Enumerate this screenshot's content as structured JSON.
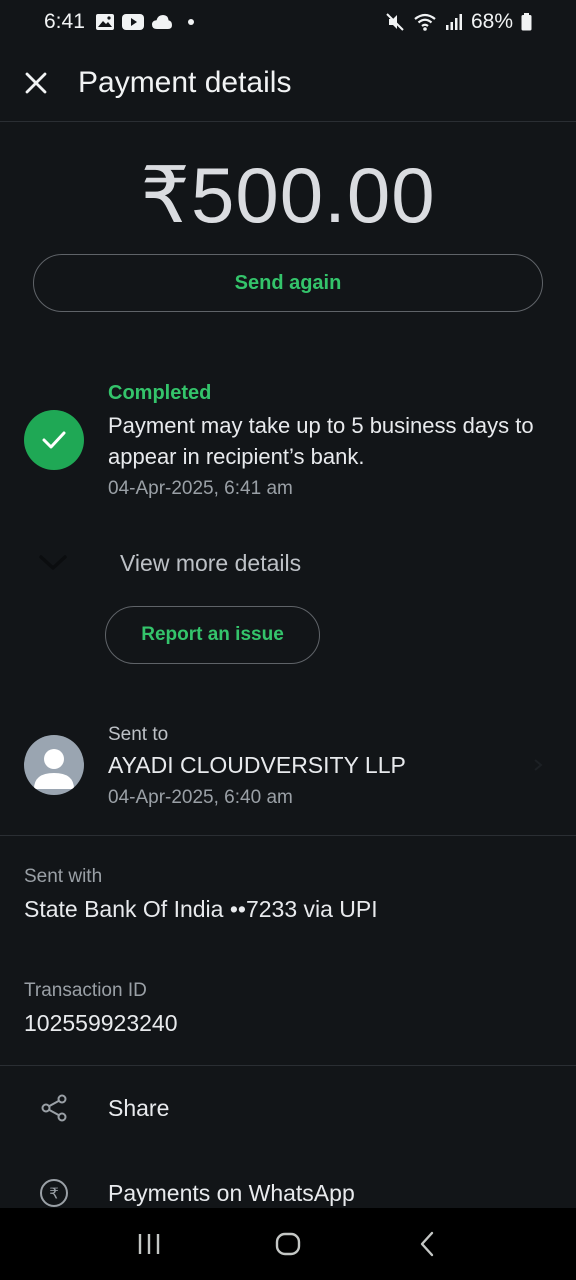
{
  "status_bar": {
    "time": "6:41",
    "battery": "68%"
  },
  "header": {
    "title": "Payment details"
  },
  "payment": {
    "amount": "₹500.00",
    "send_again_label": "Send again"
  },
  "status": {
    "label": "Completed",
    "message": "Payment may take up to 5 business days to appear in recipient’s bank.",
    "timestamp": "04-Apr-2025, 6:41 am"
  },
  "details": {
    "view_more_label": "View more details",
    "report_label": "Report an issue"
  },
  "recipient": {
    "label": "Sent to",
    "name": "AYADI CLOUDVERSITY LLP",
    "timestamp": "04-Apr-2025, 6:40 am"
  },
  "sent_with": {
    "label": "Sent with",
    "value": "State Bank Of India ••7233 via UPI"
  },
  "transaction": {
    "label": "Transaction ID",
    "value": "102559923240"
  },
  "actions": {
    "share_label": "Share",
    "whatsapp_label": "Payments on WhatsApp"
  },
  "colors": {
    "accent_green": "#34c46b",
    "status_green": "#1fa855",
    "background": "#121518"
  }
}
